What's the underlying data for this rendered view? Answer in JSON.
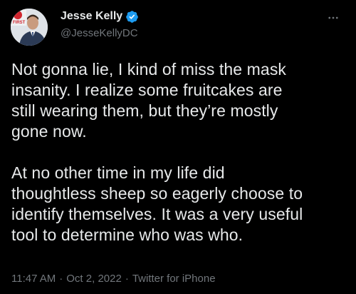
{
  "author": {
    "display_name": "Jesse Kelly",
    "handle": "@JesseKellyDC",
    "verified": true,
    "avatar_badge_text": "FIRST"
  },
  "tweet": {
    "paragraph_1": "Not gonna lie, I kind of miss the mask\ninsanity. I realize some fruitcakes are\nstill wearing them, but they’re mostly\ngone now.",
    "paragraph_2": "At no other time in my life did\nthoughtless sheep so eagerly choose to\nidentify themselves. It was a very useful\ntool to determine who was who.",
    "time": "11:47 AM",
    "date": "Oct 2, 2022",
    "source": "Twitter for iPhone",
    "separator": "·"
  },
  "colors": {
    "background": "#000000",
    "text": "#e7e9ea",
    "muted": "#71767b",
    "verified_blue": "#1d9bf0"
  },
  "icons": {
    "more": "more-horizontal-icon",
    "verified": "verified-badge-icon"
  }
}
